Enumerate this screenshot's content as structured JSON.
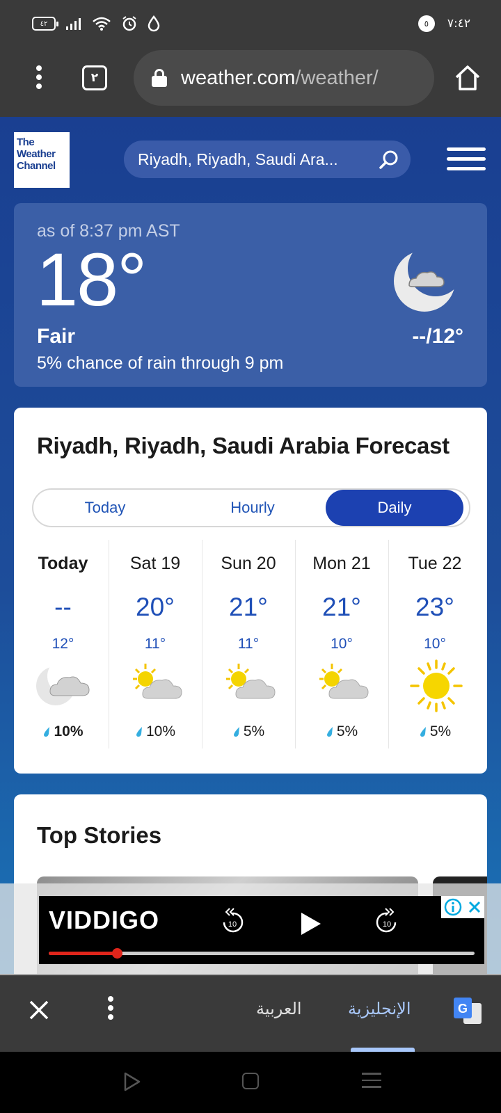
{
  "status_bar": {
    "battery": "٤٢",
    "notification_count": "٥",
    "time": "٧:٤٢"
  },
  "browser": {
    "tab_count": "٢",
    "url_host": "weather.com",
    "url_path": "/weather/"
  },
  "header": {
    "logo_lines": [
      "The",
      "Weather",
      "Channel"
    ],
    "search_value": "Riyadh, Riyadh, Saudi Ara..."
  },
  "current": {
    "as_of": "as of 8:37 pm AST",
    "temp": "18°",
    "phrase": "Fair",
    "precip": "5% chance of rain through 9 pm",
    "hi_lo": "--/12°"
  },
  "forecast": {
    "title": "Riyadh, Riyadh, Saudi Arabia Forecast",
    "tabs": [
      {
        "label": "Today"
      },
      {
        "label": "Hourly"
      },
      {
        "label": "Daily"
      }
    ],
    "active_tab": "Daily",
    "days": [
      {
        "name": "Today",
        "hi": "--",
        "lo": "12°",
        "icon": "moon-cloud-icon",
        "precip": "10%"
      },
      {
        "name": "Sat 19",
        "hi": "20°",
        "lo": "11°",
        "icon": "partly-sunny-icon",
        "precip": "10%"
      },
      {
        "name": "Sun 20",
        "hi": "21°",
        "lo": "11°",
        "icon": "partly-sunny-icon",
        "precip": "5%"
      },
      {
        "name": "Mon 21",
        "hi": "21°",
        "lo": "10°",
        "icon": "partly-sunny-icon",
        "precip": "5%"
      },
      {
        "name": "Tue 22",
        "hi": "23°",
        "lo": "10°",
        "icon": "sunny-icon",
        "precip": "5%"
      }
    ]
  },
  "stories": {
    "title": "Top Stories"
  },
  "ad": {
    "brand": "VIDDIGO",
    "skip_back": "10",
    "skip_forward": "10",
    "progress": 0.16
  },
  "translate": {
    "source_lang": "العربية",
    "target_lang": "الإنجليزية"
  },
  "colors": {
    "accent_blue": "#1c41b1",
    "temp_blue": "#1f4fb7",
    "ad_progress_red": "#e0251b"
  }
}
